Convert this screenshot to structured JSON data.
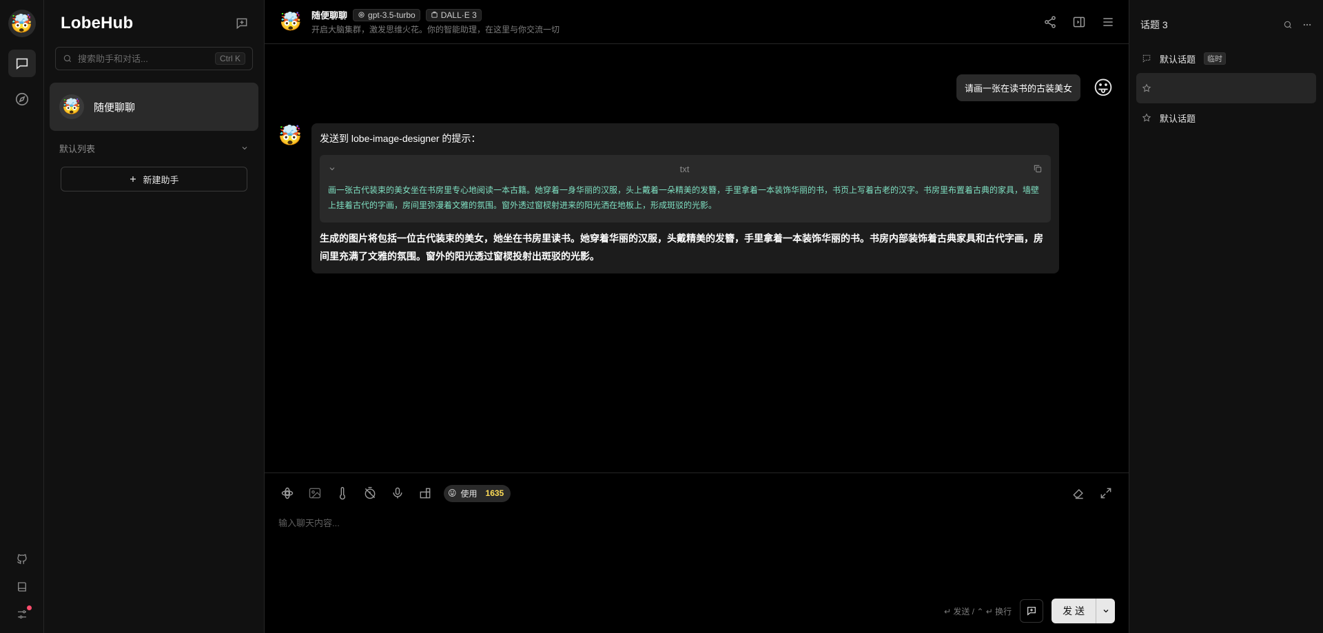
{
  "app": {
    "name": "LobeHub",
    "avatar_emoji": "🤯"
  },
  "sessions": {
    "search_placeholder": "搜索助手和对话...",
    "search_shortcut": "Ctrl K",
    "active_session": {
      "name": "随便聊聊",
      "emoji": "🤯"
    },
    "group_label": "默认列表",
    "new_assistant_label": "新建助手"
  },
  "header": {
    "title": "随便聊聊",
    "model_tag": "gpt-3.5-turbo",
    "plugin_tag": "DALL·E 3",
    "description": "开启大脑集群，激发思维火花。你的智能助理，在这里与你交流一切"
  },
  "messages": {
    "user": {
      "text": "请画一张在读书的古装美女",
      "emoji": "😛"
    },
    "assistant": {
      "emoji": "🤯",
      "lead": "发送到 lobe-image-designer 的提示：",
      "code_lang": "txt",
      "code_text": "画一张古代装束的美女坐在书房里专心地阅读一本古籍。她穿着一身华丽的汉服，头上戴着一朵精美的发簪，手里拿着一本装饰华丽的书，书页上写着古老的汉字。书房里布置着古典的家具，墙壁上挂着古代的字画，房间里弥漫着文雅的氛围。窗外透过窗棂射进来的阳光洒在地板上，形成斑驳的光影。",
      "answer": "生成的图片将包括一位古代装束的美女，她坐在书房里读书。她穿着华丽的汉服，头戴精美的发簪，手里拿着一本装饰华丽的书。书房内部装饰着古典家具和古代字画，房间里充满了文雅的氛围。窗外的阳光透过窗棂投射出斑驳的光影。"
    }
  },
  "composer": {
    "token_label": "使用",
    "token_count": "1635",
    "token_emoji": "😛",
    "placeholder": "输入聊天内容...",
    "hint": "↵ 发送 / ⌃ ↵ 换行",
    "send_label": "发 送"
  },
  "topics": {
    "title": "话题 3",
    "items": [
      {
        "label": "默认话题",
        "badge": "临时"
      },
      {
        "label": ""
      },
      {
        "label": "默认话题"
      }
    ]
  }
}
